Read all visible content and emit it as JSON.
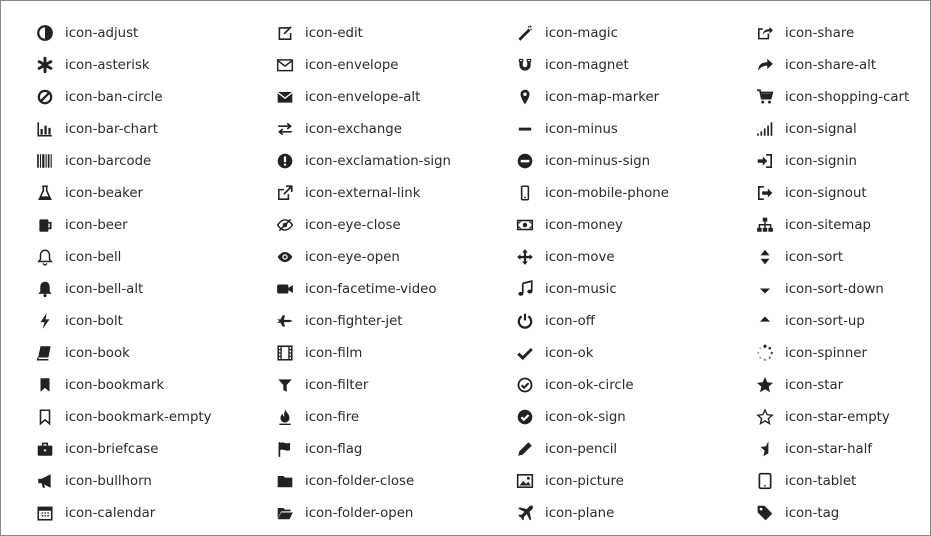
{
  "icons": [
    {
      "label": "icon-adjust",
      "icon": "adjust-icon"
    },
    {
      "label": "icon-edit",
      "icon": "edit-icon"
    },
    {
      "label": "icon-magic",
      "icon": "magic-icon"
    },
    {
      "label": "icon-share",
      "icon": "share-icon"
    },
    {
      "label": "icon-asterisk",
      "icon": "asterisk-icon"
    },
    {
      "label": "icon-envelope",
      "icon": "envelope-icon"
    },
    {
      "label": "icon-magnet",
      "icon": "magnet-icon"
    },
    {
      "label": "icon-share-alt",
      "icon": "share-alt-icon"
    },
    {
      "label": "icon-ban-circle",
      "icon": "ban-circle-icon"
    },
    {
      "label": "icon-envelope-alt",
      "icon": "envelope-alt-icon"
    },
    {
      "label": "icon-map-marker",
      "icon": "map-marker-icon"
    },
    {
      "label": "icon-shopping-cart",
      "icon": "shopping-cart-icon"
    },
    {
      "label": "icon-bar-chart",
      "icon": "bar-chart-icon"
    },
    {
      "label": "icon-exchange",
      "icon": "exchange-icon"
    },
    {
      "label": "icon-minus",
      "icon": "minus-icon"
    },
    {
      "label": "icon-signal",
      "icon": "signal-icon"
    },
    {
      "label": "icon-barcode",
      "icon": "barcode-icon"
    },
    {
      "label": "icon-exclamation-sign",
      "icon": "exclamation-sign-icon"
    },
    {
      "label": "icon-minus-sign",
      "icon": "minus-sign-icon"
    },
    {
      "label": "icon-signin",
      "icon": "signin-icon"
    },
    {
      "label": "icon-beaker",
      "icon": "beaker-icon"
    },
    {
      "label": "icon-external-link",
      "icon": "external-link-icon"
    },
    {
      "label": "icon-mobile-phone",
      "icon": "mobile-phone-icon"
    },
    {
      "label": "icon-signout",
      "icon": "signout-icon"
    },
    {
      "label": "icon-beer",
      "icon": "beer-icon"
    },
    {
      "label": "icon-eye-close",
      "icon": "eye-close-icon"
    },
    {
      "label": "icon-money",
      "icon": "money-icon"
    },
    {
      "label": "icon-sitemap",
      "icon": "sitemap-icon"
    },
    {
      "label": "icon-bell",
      "icon": "bell-icon"
    },
    {
      "label": "icon-eye-open",
      "icon": "eye-open-icon"
    },
    {
      "label": "icon-move",
      "icon": "move-icon"
    },
    {
      "label": "icon-sort",
      "icon": "sort-icon"
    },
    {
      "label": "icon-bell-alt",
      "icon": "bell-alt-icon"
    },
    {
      "label": "icon-facetime-video",
      "icon": "facetime-video-icon"
    },
    {
      "label": "icon-music",
      "icon": "music-icon"
    },
    {
      "label": "icon-sort-down",
      "icon": "sort-down-icon"
    },
    {
      "label": "icon-bolt",
      "icon": "bolt-icon"
    },
    {
      "label": "icon-fighter-jet",
      "icon": "fighter-jet-icon"
    },
    {
      "label": "icon-off",
      "icon": "off-icon"
    },
    {
      "label": "icon-sort-up",
      "icon": "sort-up-icon"
    },
    {
      "label": "icon-book",
      "icon": "book-icon"
    },
    {
      "label": "icon-film",
      "icon": "film-icon"
    },
    {
      "label": "icon-ok",
      "icon": "ok-icon"
    },
    {
      "label": "icon-spinner",
      "icon": "spinner-icon"
    },
    {
      "label": "icon-bookmark",
      "icon": "bookmark-icon"
    },
    {
      "label": "icon-filter",
      "icon": "filter-icon"
    },
    {
      "label": "icon-ok-circle",
      "icon": "ok-circle-icon"
    },
    {
      "label": "icon-star",
      "icon": "star-icon"
    },
    {
      "label": "icon-bookmark-empty",
      "icon": "bookmark-empty-icon"
    },
    {
      "label": "icon-fire",
      "icon": "fire-icon"
    },
    {
      "label": "icon-ok-sign",
      "icon": "ok-sign-icon"
    },
    {
      "label": "icon-star-empty",
      "icon": "star-empty-icon"
    },
    {
      "label": "icon-briefcase",
      "icon": "briefcase-icon"
    },
    {
      "label": "icon-flag",
      "icon": "flag-icon"
    },
    {
      "label": "icon-pencil",
      "icon": "pencil-icon"
    },
    {
      "label": "icon-star-half",
      "icon": "star-half-icon"
    },
    {
      "label": "icon-bullhorn",
      "icon": "bullhorn-icon"
    },
    {
      "label": "icon-folder-close",
      "icon": "folder-close-icon"
    },
    {
      "label": "icon-picture",
      "icon": "picture-icon"
    },
    {
      "label": "icon-tablet",
      "icon": "tablet-icon"
    },
    {
      "label": "icon-calendar",
      "icon": "calendar-icon"
    },
    {
      "label": "icon-folder-open",
      "icon": "folder-open-icon"
    },
    {
      "label": "icon-plane",
      "icon": "plane-icon"
    },
    {
      "label": "icon-tag",
      "icon": "tag-icon"
    }
  ],
  "colors": {
    "icon": "#222222",
    "text": "#2b2b2b",
    "border": "#8a8a8a",
    "background": "#ffffff"
  }
}
